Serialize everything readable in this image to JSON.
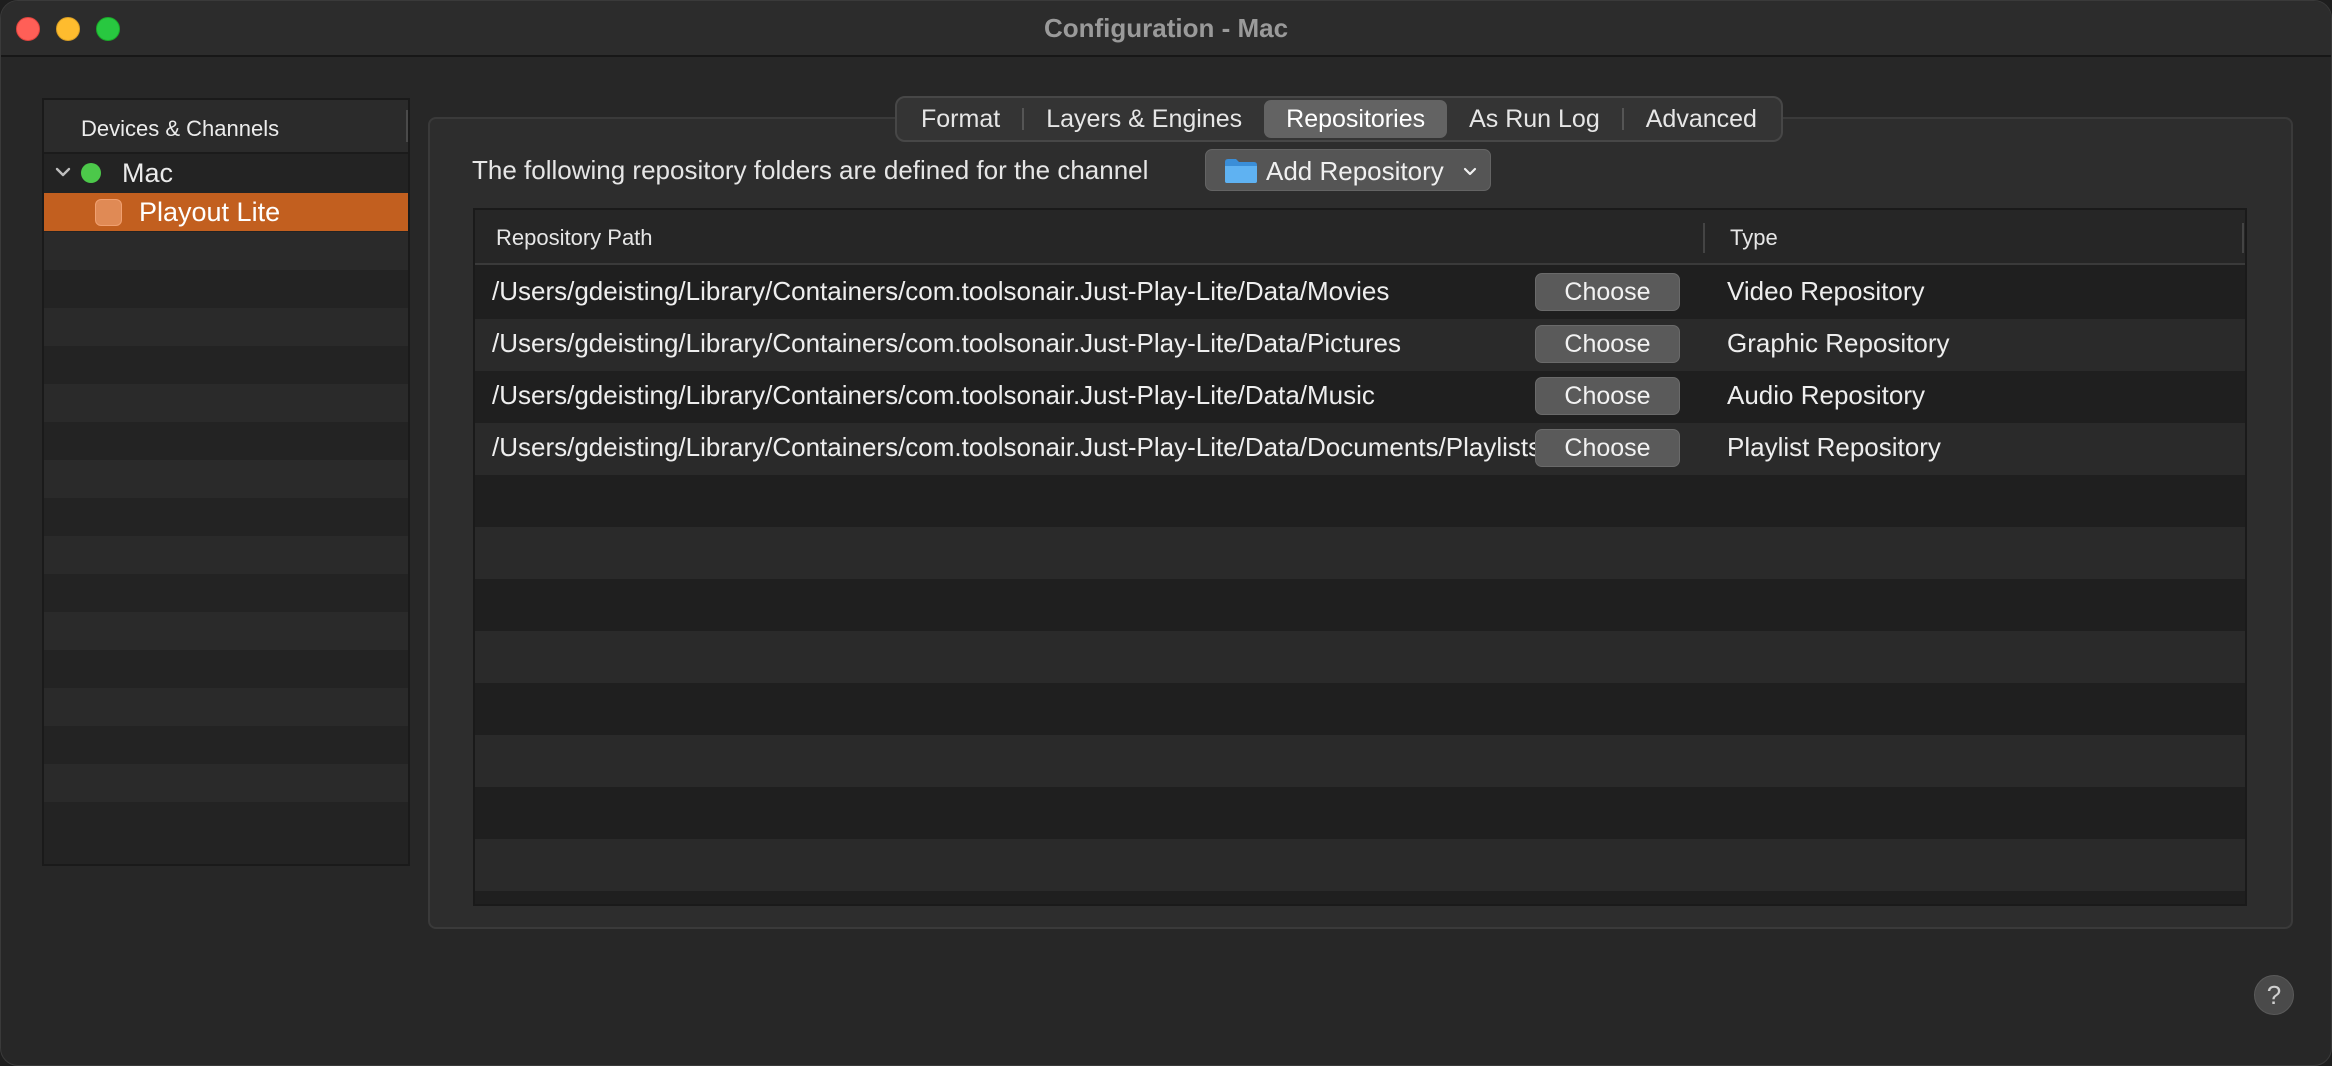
{
  "window": {
    "title": "Configuration - Mac"
  },
  "sidebar": {
    "header": "Devices & Channels",
    "device": {
      "label": "Mac",
      "status_color": "#4cc84a"
    },
    "channel": {
      "label": "Playout Lite",
      "selected_color": "#c25f1f"
    }
  },
  "tabs": [
    {
      "label": "Format",
      "active": false
    },
    {
      "label": "Layers & Engines",
      "active": false
    },
    {
      "label": "Repositories",
      "active": true
    },
    {
      "label": "As Run Log",
      "active": false
    },
    {
      "label": "Advanced",
      "active": false
    }
  ],
  "repositories": {
    "description": "The following repository folders are defined for the channel",
    "add_button_label": "Add Repository",
    "columns": {
      "path": "Repository Path",
      "type": "Type"
    },
    "choose_label": "Choose",
    "rows": [
      {
        "path": "/Users/gdeisting/Library/Containers/com.toolsonair.Just-Play-Lite/Data/Movies",
        "type": "Video Repository"
      },
      {
        "path": "/Users/gdeisting/Library/Containers/com.toolsonair.Just-Play-Lite/Data/Pictures",
        "type": "Graphic Repository"
      },
      {
        "path": "/Users/gdeisting/Library/Containers/com.toolsonair.Just-Play-Lite/Data/Music",
        "type": "Audio Repository"
      },
      {
        "path": "/Users/gdeisting/Library/Containers/com.toolsonair.Just-Play-Lite/Data/Documents/Playlists",
        "type": "Playlist Repository"
      }
    ]
  },
  "help": {
    "label": "?"
  }
}
